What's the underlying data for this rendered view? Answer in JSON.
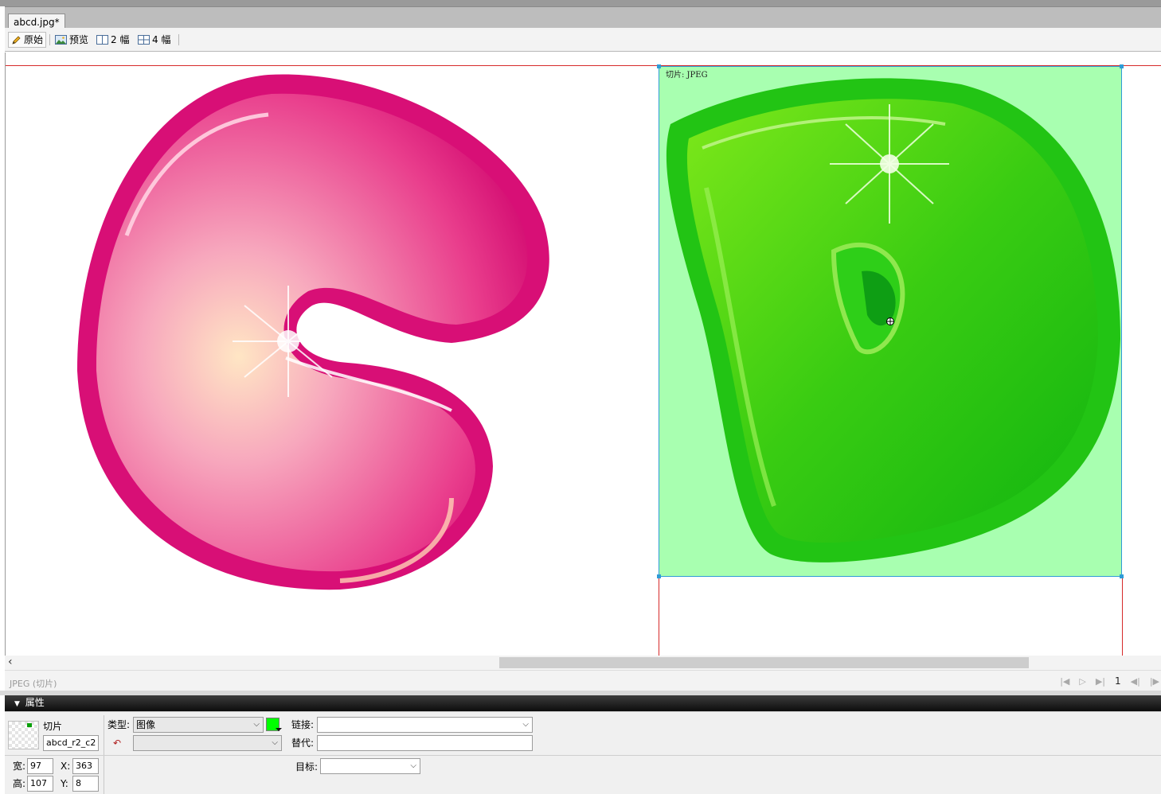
{
  "document": {
    "tab_title": "abcd.jpg*"
  },
  "toolbar": {
    "original": "原始",
    "preview": "预览",
    "two_up": "2 幅",
    "four_up": "4 幅"
  },
  "canvas": {
    "slice_label": "切片: JPEG",
    "slice_overlay_color": "#a8ffb0",
    "slice_border_color": "#2f9bd6",
    "guide_color": "#d62a2a"
  },
  "status": {
    "text": "JPEG (切片)",
    "page_number": "1"
  },
  "properties_panel": {
    "title": "属性",
    "object_type": "切片",
    "slice_name": "abcd_r2_c2",
    "type_label": "类型:",
    "type_value": "图像",
    "slice_color": "#00ff00",
    "link_label": "链接:",
    "link_value": "",
    "alt_label": "替代:",
    "alt_value": "",
    "target_label": "目标:",
    "target_value": "",
    "width_label": "宽:",
    "width_value": "97",
    "height_label": "高:",
    "height_value": "107",
    "x_label": "X:",
    "x_value": "363",
    "y_label": "Y:",
    "y_value": "8"
  }
}
